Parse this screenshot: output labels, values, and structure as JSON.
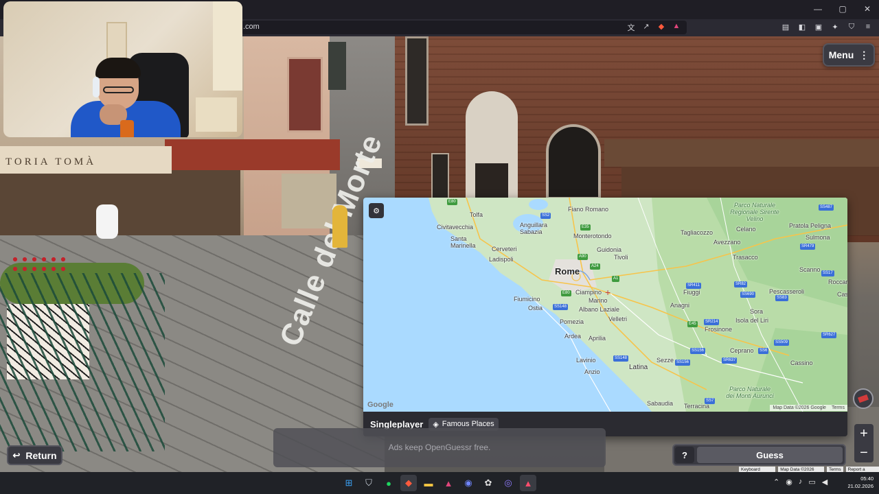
{
  "browser": {
    "url_fragment": ".com",
    "window_controls": {
      "minimize": "—",
      "maximize": "▢",
      "close": "✕"
    }
  },
  "scene": {
    "shop_sign": "TORIA   TOMÀ",
    "street_name": "Calle del Morte"
  },
  "game": {
    "menu_label": "Menu",
    "return_label": "Return",
    "ad_text": "Ads keep OpenGuessr free.",
    "mode_label": "Singleplayer",
    "place_badge": "Famous Places",
    "help_label": "?",
    "guess_label": "Guess",
    "zoom_in": "+",
    "zoom_out": "−"
  },
  "map": {
    "google_logo": "Google",
    "attribution": [
      "Map Data ©2026 Google",
      "Terms"
    ],
    "labels": {
      "rome": "Rome",
      "tolfa": "Tolfa",
      "civitavecchia": "Civitavecchia",
      "fiano_romano": "Fiano Romano",
      "anguillara": "Anguillara Sabazia",
      "monterotondo": "Monterotondo",
      "guidonia": "Guidonia",
      "tivoli": "Tivoli",
      "santa_marinella": "Santa Marinella",
      "cerveteri": "Cerveteri",
      "ladispoli": "Ladispoli",
      "fiumicino": "Fiumicino",
      "ostia": "Ostia",
      "ciampino": "Ciampino",
      "marino": "Marino",
      "albano": "Albano Laziale",
      "velletri": "Velletri",
      "pomezia": "Pomezia",
      "ardea": "Ardea",
      "aprilia": "Aprilia",
      "lavinio": "Lavinio",
      "anzio": "Anzio",
      "latina": "Latina",
      "sezze": "Sezze",
      "sabaudia": "Sabaudia",
      "terracina": "Terracina",
      "tagliacozzo": "Tagliacozzo",
      "avezzano": "Avezzano",
      "celano": "Celano",
      "pratola": "Pratola Peligna",
      "sulmona": "Sulmona",
      "trasacco": "Trasacco",
      "scanno": "Scanno",
      "roccaraso": "Roccaraso",
      "pescasseroli": "Pescasseroli",
      "fiuggi": "Fiuggi",
      "anagni": "Anagni",
      "castel_sangro": "Castel di Sangro",
      "sora": "Sora",
      "isola_liri": "Isola del Liri",
      "frosinone": "Frosinone",
      "ceprano": "Ceprano",
      "cassino": "Cassino",
      "parco_sirente": "Parco Naturale Regionale Sirente Velino",
      "parco_aurunci": "Parco Naturale dei Monti Aurunci"
    }
  },
  "taskbar": {
    "clock_time": "05:40",
    "clock_date": "21.02.2026"
  },
  "footer_links": [
    "Keyboard shortcuts",
    "Map Data ©2026 Google",
    "Terms",
    "Report a problem"
  ]
}
